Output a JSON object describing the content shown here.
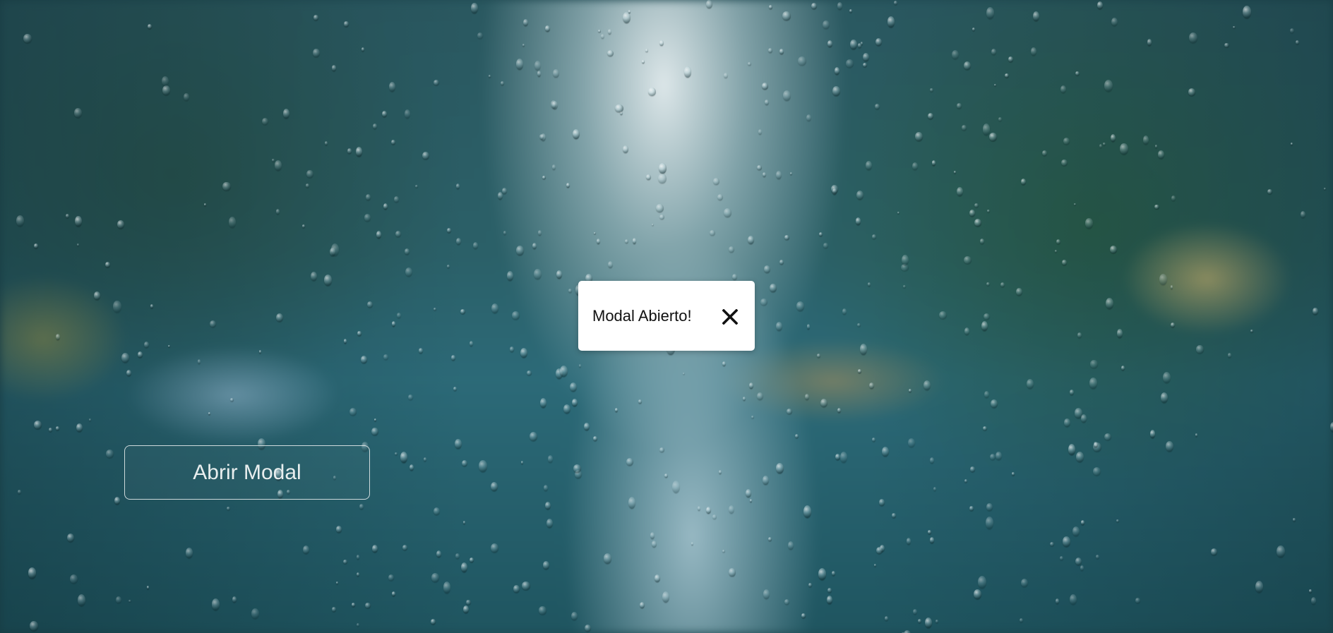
{
  "modal": {
    "message": "Modal Abierto!",
    "close_icon": "close-icon"
  },
  "open_button": {
    "label": "Abrir Modal"
  },
  "background": {
    "description_icon": "rainy-street-background"
  }
}
